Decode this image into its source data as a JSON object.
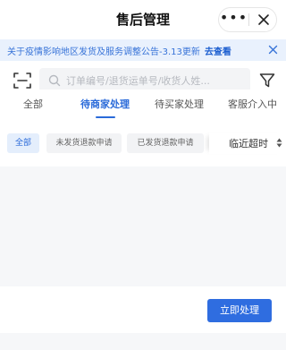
{
  "nav": {
    "title": "售后管理",
    "more_label": "•••"
  },
  "notice": {
    "text": "关于疫情影响地区发货及服务调整公告-3.13更新",
    "link": "去查看"
  },
  "search": {
    "placeholder": "订单编号/退货运单号/收货人姓..."
  },
  "tabs": [
    {
      "label": "全部"
    },
    {
      "label": "待商家处理"
    },
    {
      "label": "待买家处理"
    },
    {
      "label": "客服介入中"
    }
  ],
  "chips": [
    {
      "label": "全部"
    },
    {
      "label": "未发货退款申请"
    },
    {
      "label": "已发货退款申请"
    }
  ],
  "sort": {
    "label": "临近超时"
  },
  "footer": {
    "action_label": "立即处理"
  },
  "colors": {
    "accent": "#2a6ad9",
    "button": "#2f6de0",
    "notice_bg": "#e9f1fd"
  }
}
